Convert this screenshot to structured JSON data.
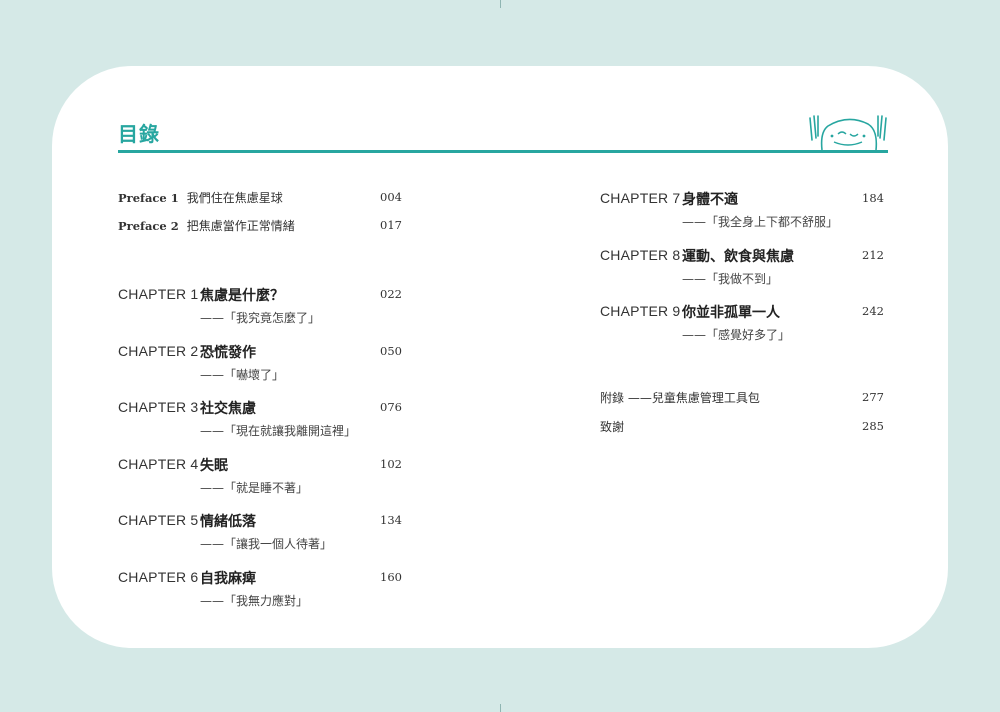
{
  "title": "目錄",
  "prefaces": [
    {
      "label": "Preface 1",
      "title": "我們住在焦慮星球",
      "page": "004"
    },
    {
      "label": "Preface 2",
      "title": "把焦慮當作正常情緒",
      "page": "017"
    }
  ],
  "chapters": [
    {
      "label": "CHAPTER 1",
      "title": "焦慮是什麼？",
      "subtitle": "——「我究竟怎麼了」",
      "page": "022"
    },
    {
      "label": "CHAPTER 2",
      "title": "恐慌發作",
      "subtitle": "——「嚇壞了」",
      "page": "050"
    },
    {
      "label": "CHAPTER 3",
      "title": "社交焦慮",
      "subtitle": "——「現在就讓我離開這裡」",
      "page": "076"
    },
    {
      "label": "CHAPTER 4",
      "title": "失眠",
      "subtitle": "——「就是睡不著」",
      "page": "102"
    },
    {
      "label": "CHAPTER 5",
      "title": "情緒低落",
      "subtitle": "——「讓我一個人待著」",
      "page": "134"
    },
    {
      "label": "CHAPTER 6",
      "title": "自我麻痺",
      "subtitle": "——「我無力應對」",
      "page": "160"
    },
    {
      "label": "CHAPTER 7",
      "title": "身體不適",
      "subtitle": "——「我全身上下都不舒服」",
      "page": "184"
    },
    {
      "label": "CHAPTER 8",
      "title": "運動、飲食與焦慮",
      "subtitle": "——「我做不到」",
      "page": "212"
    },
    {
      "label": "CHAPTER 9",
      "title": "你並非孤單一人",
      "subtitle": "——「感覺好多了」",
      "page": "242"
    }
  ],
  "appendix": {
    "title": "附錄 ——兒童焦慮管理工具包",
    "page": "277"
  },
  "thanks": {
    "title": "致謝",
    "page": "285"
  },
  "colors": {
    "accent": "#27a6a0",
    "background": "#d5e9e7"
  }
}
